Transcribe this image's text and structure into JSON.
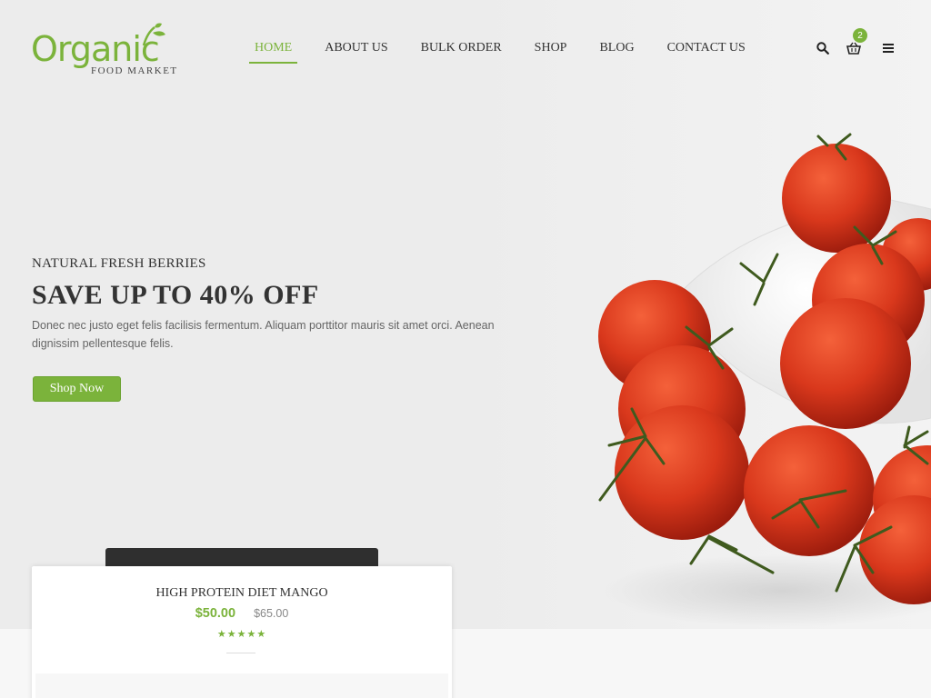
{
  "brand": {
    "name": "Organic",
    "tagline": "FOOD MARKET",
    "color": "#7bb33b"
  },
  "nav": {
    "items": [
      "HOME",
      "ABOUT US",
      "BULK ORDER",
      "SHOP",
      "BLOG",
      "CONTACT US"
    ],
    "active": "HOME"
  },
  "header_icons": {
    "search": "search-icon",
    "cart": "basket-icon",
    "cart_count": "2",
    "menu": "hamburger-icon"
  },
  "hero": {
    "eyebrow": "NATURAL FRESH BERRIES",
    "headline": "SAVE UP TO 40% OFF",
    "description": "Donec nec justo eget felis facilisis fermentum. Aliquam porttitor mauris sit amet orci. Aenean dignissim pellentesque felis.",
    "cta": "Shop Now"
  },
  "product": {
    "title": "HIGH PROTEIN DIET MANGO",
    "price": "$50.00",
    "old_price": "$65.00",
    "rating": 5,
    "rating_max": 5
  }
}
